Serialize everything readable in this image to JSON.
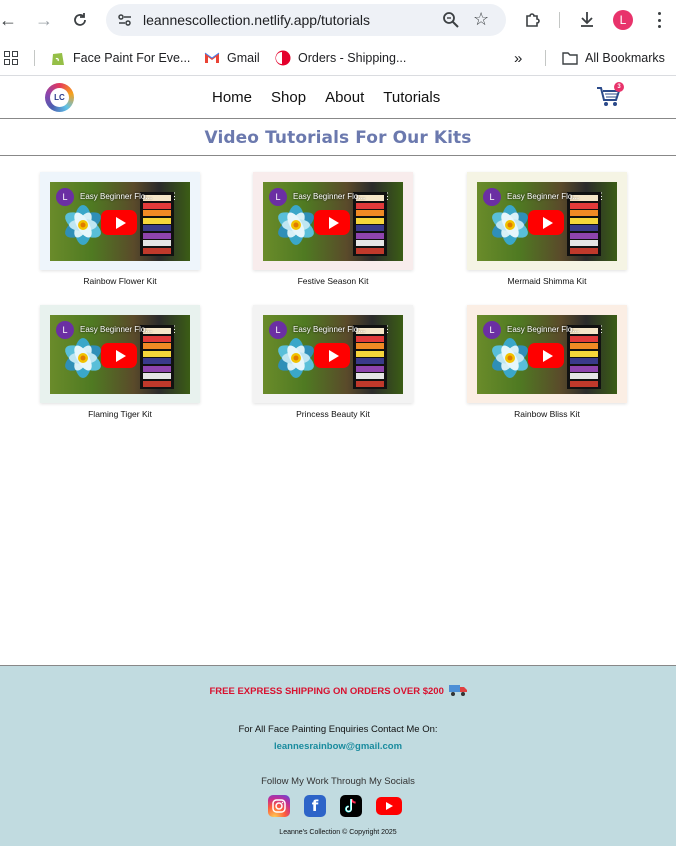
{
  "browser": {
    "url": "leannescollection.netlify.app/tutorials",
    "profile_initial": "L",
    "bookmarks": [
      {
        "label": "Face Paint For Eve...",
        "icon": "shopify-icon"
      },
      {
        "label": "Gmail",
        "icon": "gmail-icon"
      },
      {
        "label": "Orders - Shipping...",
        "icon": "shipping-icon"
      }
    ],
    "all_bookmarks_label": "All Bookmarks"
  },
  "site": {
    "logo_text": "LC",
    "nav": [
      "Home",
      "Shop",
      "About",
      "Tutorials"
    ],
    "cart_count": "3"
  },
  "page": {
    "title": "Video Tutorials For Our Kits",
    "video_channel_initial": "L",
    "video_title": "Easy Beginner Flo...",
    "kits": [
      {
        "label": "Rainbow Flower Kit",
        "bg": "#eef5fb"
      },
      {
        "label": "Festive Season Kit",
        "bg": "#f8ecec"
      },
      {
        "label": "Mermaid Shimma Kit",
        "bg": "#f5f4e4"
      },
      {
        "label": "Flaming Tiger Kit",
        "bg": "#e8f2ee"
      },
      {
        "label": "Princess Beauty Kit",
        "bg": "#f3f3f3"
      },
      {
        "label": "Rainbow Bliss Kit",
        "bg": "#fbeee4"
      }
    ]
  },
  "footer": {
    "shipping": "FREE EXPRESS SHIPPING ON ORDERS OVER $200",
    "enquiries": "For All Face Painting Enquiries Contact Me On:",
    "email": "leannesrainbow@gmail.com",
    "follow": "Follow My Work Through My Socials",
    "socials": [
      "instagram-icon",
      "facebook-icon",
      "tiktok-icon",
      "youtube-icon"
    ],
    "copyright": "Leanne's Collection © Copyright 2025"
  }
}
